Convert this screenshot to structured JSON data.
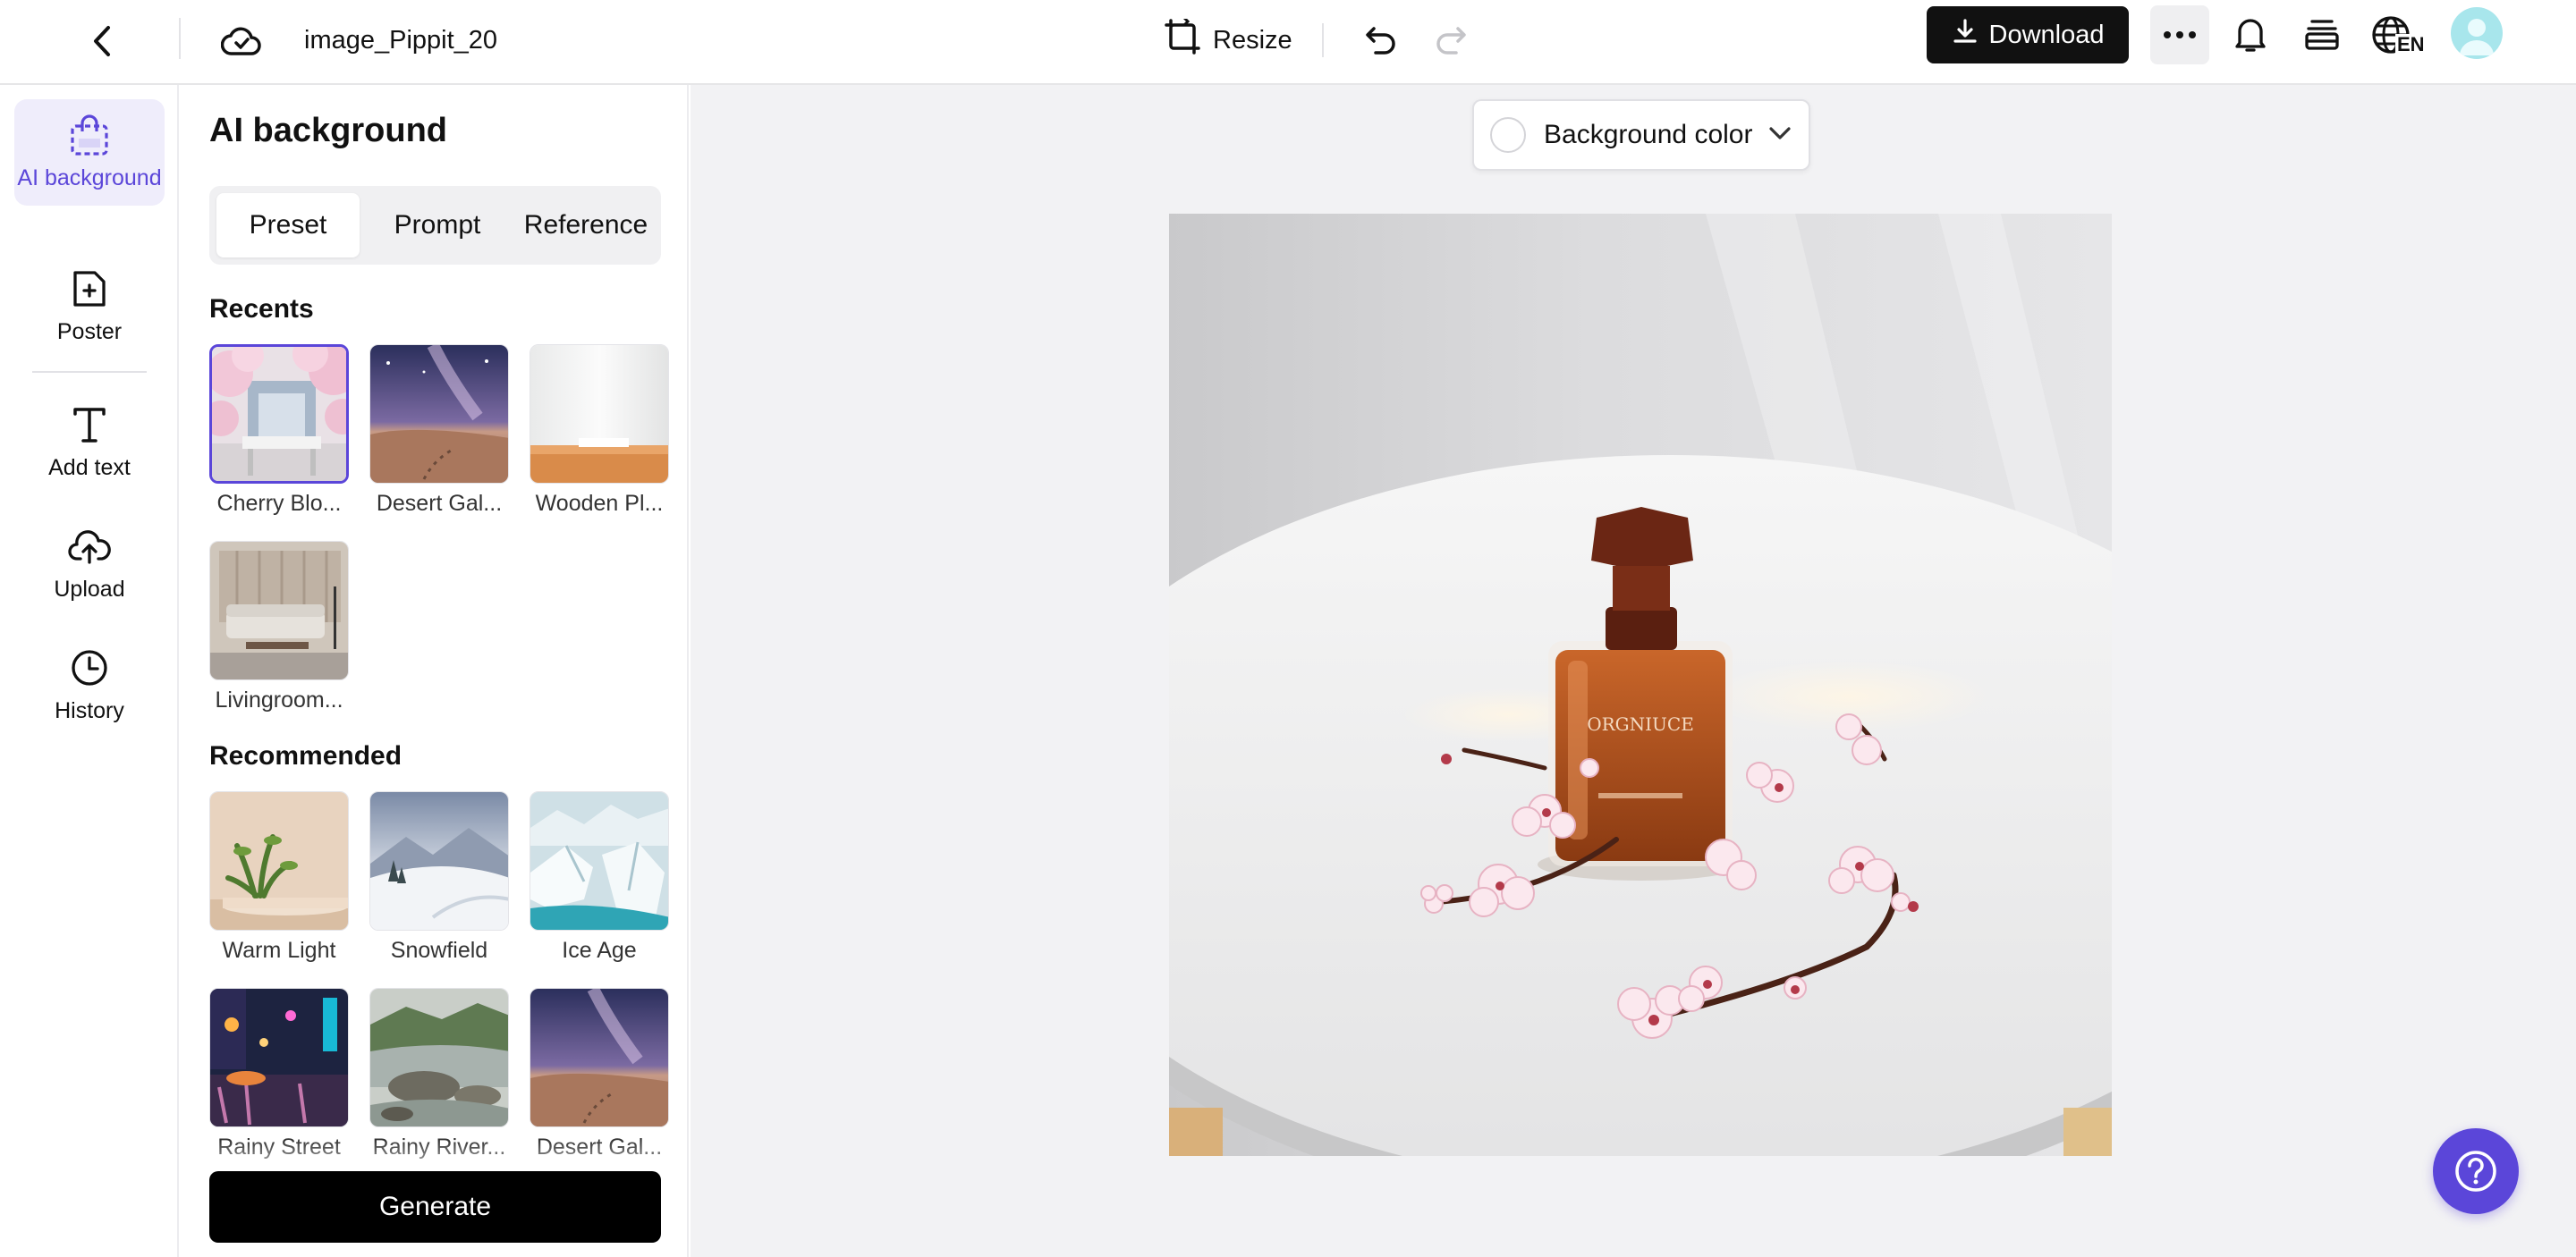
{
  "topbar": {
    "filename": "image_Pippit_20",
    "resize_label": "Resize",
    "download_label": "Download",
    "language_code": "EN"
  },
  "rail": {
    "items": [
      {
        "label": "AI background",
        "icon": "bag-icon",
        "active": true
      },
      {
        "label": "Poster",
        "icon": "poster-icon"
      },
      {
        "label": "Add text",
        "icon": "text-icon"
      },
      {
        "label": "Upload",
        "icon": "cloud-upload-icon"
      },
      {
        "label": "History",
        "icon": "clock-icon"
      }
    ]
  },
  "panel": {
    "title": "AI background",
    "tabs": [
      {
        "label": "Preset",
        "active": true
      },
      {
        "label": "Prompt"
      },
      {
        "label": "Reference"
      }
    ],
    "recents_title": "Recents",
    "recents": [
      {
        "label": "Cherry Blo...",
        "selected": true
      },
      {
        "label": "Desert Gal..."
      },
      {
        "label": "Wooden Pl..."
      },
      {
        "label": "Livingroom..."
      }
    ],
    "recommended_title": "Recommended",
    "recommended": [
      {
        "label": "Warm Light"
      },
      {
        "label": "Snowfield"
      },
      {
        "label": "Ice Age"
      },
      {
        "label": "Rainy Street"
      },
      {
        "label": "Rainy River..."
      },
      {
        "label": "Desert Gal..."
      }
    ],
    "generate_label": "Generate"
  },
  "canvas": {
    "background_color_label": "Background color",
    "product_label_text": "ORGNIUCE"
  },
  "colors": {
    "accent": "#5b46d9",
    "primary_button": "#111111",
    "canvas_bg": "#f2f2f4"
  }
}
